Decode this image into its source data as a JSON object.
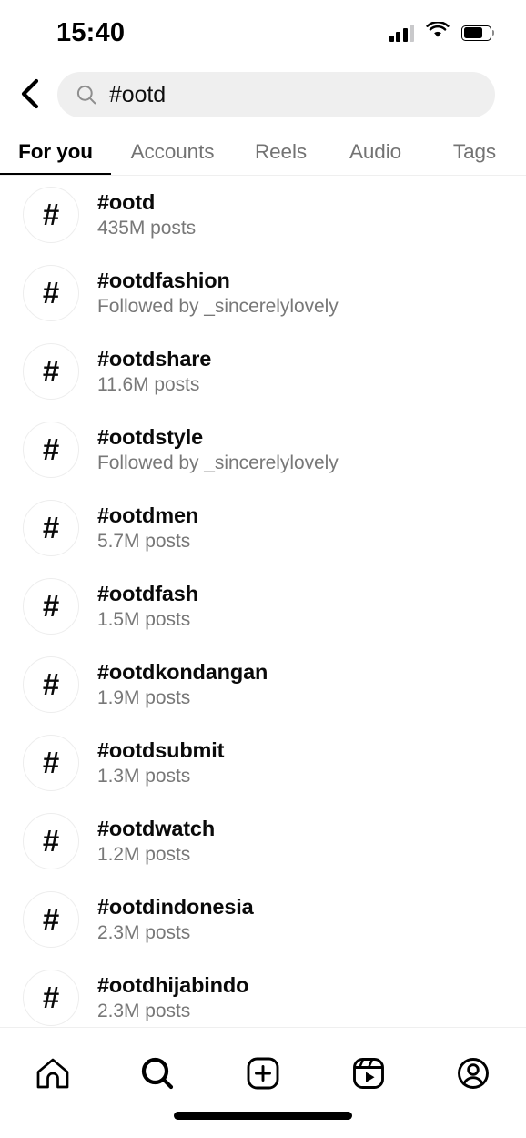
{
  "status_bar": {
    "time": "15:40",
    "signal_icon": "cellular-signal-icon",
    "wifi_icon": "wifi-icon",
    "battery_icon": "battery-icon",
    "battery_level_percent": 72
  },
  "header": {
    "back_icon": "back-chevron-icon",
    "search": {
      "icon": "search-icon",
      "value": "#ootd",
      "placeholder": "Search"
    }
  },
  "tabs": {
    "items": [
      {
        "label": "For you",
        "active": true
      },
      {
        "label": "Accounts",
        "active": false
      },
      {
        "label": "Reels",
        "active": false
      },
      {
        "label": "Audio",
        "active": false
      },
      {
        "label": "Tags",
        "active": false
      }
    ]
  },
  "results": {
    "avatar_glyph": "#",
    "items": [
      {
        "title": "#ootd",
        "subtitle": "435M posts"
      },
      {
        "title": "#ootdfashion",
        "subtitle": "Followed by _sincerelylovely"
      },
      {
        "title": "#ootdshare",
        "subtitle": "11.6M posts"
      },
      {
        "title": "#ootdstyle",
        "subtitle": "Followed by _sincerelylovely"
      },
      {
        "title": "#ootdmen",
        "subtitle": "5.7M posts"
      },
      {
        "title": "#ootdfash",
        "subtitle": "1.5M posts"
      },
      {
        "title": "#ootdkondangan",
        "subtitle": "1.9M posts"
      },
      {
        "title": "#ootdsubmit",
        "subtitle": "1.3M posts"
      },
      {
        "title": "#ootdwatch",
        "subtitle": "1.2M posts"
      },
      {
        "title": "#ootdindonesia",
        "subtitle": "2.3M posts"
      },
      {
        "title": "#ootdhijabindo",
        "subtitle": "2.3M posts"
      }
    ]
  },
  "bottom_nav": {
    "items": [
      {
        "icon": "home-icon",
        "active": false
      },
      {
        "icon": "search-icon",
        "active": true
      },
      {
        "icon": "create-icon",
        "active": false
      },
      {
        "icon": "reels-icon",
        "active": false
      },
      {
        "icon": "profile-icon",
        "active": false
      }
    ]
  },
  "colors": {
    "background": "#ffffff",
    "primary_text": "#0a0a0a",
    "secondary_text": "#787878",
    "search_field": "#efefef",
    "divider": "#efefef"
  }
}
